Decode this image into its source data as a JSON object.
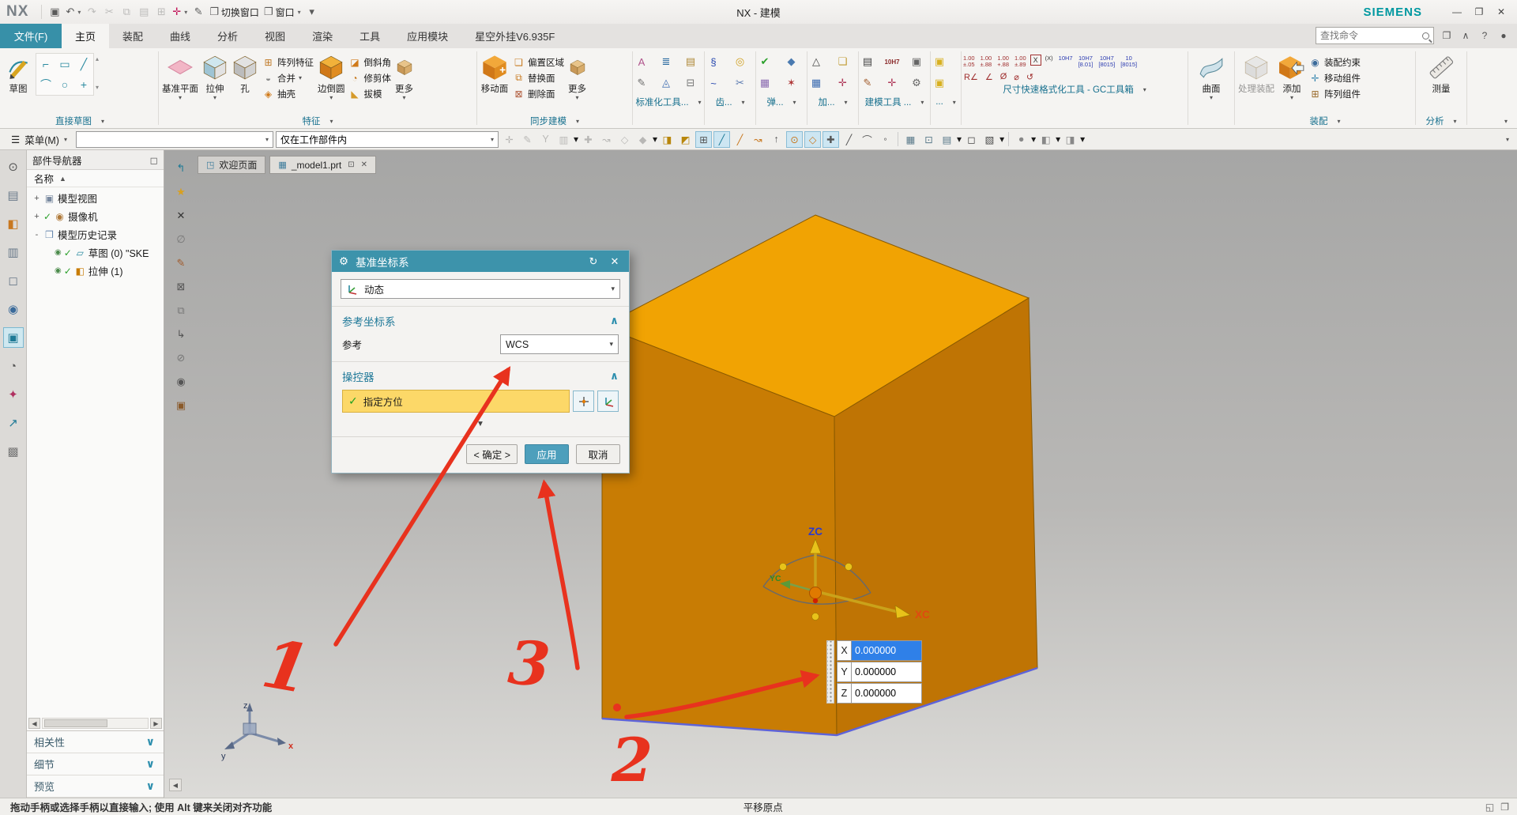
{
  "glyphs": {
    "dropdown": "▾",
    "dropdown_large": "▼",
    "collapse": "∧",
    "expand": "∨",
    "check": "✓",
    "sort": "▲",
    "scroll_left": "◀",
    "scroll_right": "▶",
    "menu": "☰",
    "close": "✕",
    "refresh": "↻",
    "gear": "⚙",
    "pin": "⊡",
    "minimize": "—",
    "maximize": "❐",
    "help": "?",
    "dot": "●",
    "up": "▴",
    "down": "▾",
    "panel": "◻"
  },
  "titlebar": {
    "app_name": "NX",
    "window_title": "NX - 建模",
    "brand": "SIEMENS",
    "icons": [
      {
        "name": "save-icon",
        "glyph": "▣"
      },
      {
        "name": "undo-icon",
        "glyph": "↶",
        "drop": true
      },
      {
        "name": "redo-icon",
        "glyph": "↷",
        "disabled": true
      },
      {
        "name": "cut-icon",
        "glyph": "✂",
        "disabled": true
      },
      {
        "name": "copy-icon",
        "glyph": "⧉",
        "disabled": true
      },
      {
        "name": "paste-icon",
        "glyph": "▤",
        "disabled": true
      },
      {
        "name": "paste-special-icon",
        "glyph": "⊞",
        "disabled": true
      },
      {
        "name": "wcs-orient-icon",
        "glyph": "✛",
        "color": "#c2185b",
        "drop": true
      },
      {
        "name": "brush-icon",
        "glyph": "✎"
      },
      {
        "name": "switch-window-icon",
        "glyph": "❐",
        "label": "切换窗口"
      },
      {
        "name": "window-icon",
        "glyph": "❐",
        "label": "窗口",
        "drop": true
      },
      {
        "name": "qat-overflow-icon",
        "glyph": "▾"
      }
    ],
    "window_buttons": [
      {
        "name": "minimize-button",
        "glyph": "—"
      },
      {
        "name": "maximize-button",
        "glyph": "❐"
      },
      {
        "name": "close-button",
        "glyph": "✕"
      }
    ]
  },
  "menubar": {
    "file_tab": "文件(F)",
    "tabs": [
      "主页",
      "装配",
      "曲线",
      "分析",
      "视图",
      "渲染",
      "工具",
      "应用模块",
      "星空外挂V6.935F"
    ],
    "active_tab": "主页",
    "search_placeholder": "查找命令",
    "right_icons": [
      {
        "name": "fullscreen-icon",
        "glyph": "❐"
      },
      {
        "name": "minimize-ribbon-icon",
        "glyph": "∧"
      },
      {
        "name": "help-icon",
        "glyph": "?"
      },
      {
        "name": "presence-icon",
        "glyph": "●"
      }
    ]
  },
  "ribbon": {
    "sketch": {
      "label_group": "直接草图",
      "button": {
        "label": "草图",
        "icon": "sketch"
      },
      "mini": [
        "⌐",
        "▭",
        "╱",
        "⌒",
        "○",
        "+"
      ]
    },
    "feature": {
      "label_group": "特征",
      "big": [
        {
          "label": "基准平面",
          "icon": "datum-plane",
          "drop": true
        },
        {
          "label": "拉伸",
          "icon": "extrude",
          "drop": true
        },
        {
          "label": "孔",
          "icon": "hole"
        }
      ],
      "stack1": [
        {
          "glyph": "⊞",
          "color": "#c07a28",
          "label": "阵列特征"
        },
        {
          "glyph": "◒",
          "color": "#8a8a8a",
          "label": "合并",
          "drop": true
        },
        {
          "glyph": "◈",
          "color": "#d07a1a",
          "label": "抽壳"
        }
      ],
      "fillet": {
        "label": "边倒圆",
        "icon": "fillet",
        "drop": true
      },
      "stack2": [
        {
          "glyph": "◪",
          "color": "#d07a1a",
          "label": "倒斜角"
        },
        {
          "glyph": "◔",
          "color": "#c87a20",
          "label": "修剪体"
        },
        {
          "glyph": "◣",
          "color": "#d59a2a",
          "label": "拔模"
        }
      ],
      "more": {
        "label": "更多",
        "icon": "more",
        "drop": true
      }
    },
    "sync": {
      "label_group": "同步建模",
      "big": {
        "label": "移动面",
        "icon": "move-face"
      },
      "stack": [
        {
          "glyph": "❏",
          "color": "#c87a20",
          "label": "偏置区域"
        },
        {
          "glyph": "⧉",
          "color": "#c87a20",
          "label": "替换面"
        },
        {
          "glyph": "⊠",
          "color": "#b05a3a",
          "label": "删除面"
        }
      ],
      "more": {
        "label": "更多",
        "icon": "more",
        "drop": true
      }
    },
    "clusters": [
      {
        "label_group": "标准化工具...",
        "icons": [
          {
            "glyph": "A",
            "color": "#b0548c"
          },
          {
            "glyph": "✎",
            "color": "#6a6a6a"
          },
          {
            "glyph": "≣",
            "color": "#2a6aa0"
          },
          {
            "glyph": "◬",
            "color": "#3a6ab0"
          },
          {
            "glyph": "▤",
            "color": "#b08a3a"
          },
          {
            "glyph": "⊟",
            "color": "#777777"
          }
        ]
      },
      {
        "label_group": "齿...",
        "icons": [
          {
            "glyph": "§",
            "color": "#2a4ab0"
          },
          {
            "glyph": "~",
            "color": "#2a4ab0"
          },
          {
            "glyph": "◎",
            "color": "#d0a020"
          },
          {
            "glyph": "✂",
            "color": "#5a7ab0"
          }
        ]
      },
      {
        "label_group": "弹...",
        "icons": [
          {
            "glyph": "✔",
            "color": "#2aa02a"
          },
          {
            "glyph": "▦",
            "color": "#8a6ab0"
          },
          {
            "glyph": "◆",
            "color": "#4a7ab0"
          },
          {
            "glyph": "✶",
            "color": "#b03a3a"
          }
        ]
      },
      {
        "label_group": "加...",
        "icons": [
          {
            "glyph": "△",
            "color": "#444444"
          },
          {
            "glyph": "▦",
            "color": "#3a6ab0"
          },
          {
            "glyph": "❏",
            "color": "#c09a30"
          },
          {
            "glyph": "✛",
            "color": "#b03a5a"
          }
        ]
      },
      {
        "label_group": "建模工具 ...",
        "icons": [
          {
            "glyph": "▤",
            "color": "#444444"
          },
          {
            "glyph": "✎",
            "color": "#a05a2a"
          },
          {
            "glyph": "10H7",
            "color": "#8a2a2a",
            "text": true
          },
          {
            "glyph": "✛",
            "color": "#b03a5a"
          },
          {
            "glyph": "▣",
            "color": "#666666"
          },
          {
            "glyph": "⚙",
            "color": "#666666"
          }
        ]
      },
      {
        "label_group": "...",
        "icons": [
          {
            "glyph": "▣",
            "color": "#d8b020"
          },
          {
            "glyph": "▣",
            "color": "#d8b020"
          }
        ]
      }
    ],
    "gc": {
      "label_group": "尺寸快速格式化工具 - GC工具箱",
      "row1": [
        "1.00\n±.05",
        "1.00\n±.88",
        "1.00\n+.88",
        "1.00\n±.89"
      ],
      "row1_boxed": "X",
      "row1_paren": "(X)",
      "row1_fits": [
        "10H7",
        "10H7\n[8.01]",
        "10H7\n[8015]",
        "10\n[8015]"
      ],
      "row2": [
        "R∠",
        "∠",
        "Ø",
        "⌀",
        "↺"
      ]
    },
    "surface": {
      "label_group": "",
      "button": {
        "label": "曲面",
        "icon": "surface",
        "drop": true
      }
    },
    "assembly": {
      "label_group": "装配",
      "process": {
        "label": "处理装配",
        "icon": "process"
      },
      "add": {
        "label": "添加",
        "icon": "add",
        "drop": true
      },
      "stack": [
        {
          "glyph": "◉",
          "color": "#3a6a9a",
          "label": "装配约束"
        },
        {
          "glyph": "✛",
          "color": "#3a87b0",
          "label": "移动组件"
        },
        {
          "glyph": "⊞",
          "color": "#9a6a2a",
          "label": "阵列组件"
        }
      ]
    },
    "analysis": {
      "label_group": "分析",
      "button": {
        "label": "测量",
        "icon": "measure"
      }
    }
  },
  "toolbar": {
    "menu_button": "菜单(M)",
    "selection_scope": "仅在工作部件内",
    "icons": [
      {
        "name": "extract-icon",
        "glyph": "✛",
        "state": "disabled"
      },
      {
        "name": "sketch-curve-icon",
        "glyph": "✎",
        "state": "disabled"
      },
      {
        "name": "spline-icon",
        "glyph": "Y",
        "state": "disabled"
      },
      {
        "name": "sheet-icon",
        "glyph": "▥",
        "state": "disabled",
        "drop": true
      },
      {
        "name": "anchor-icon",
        "glyph": "✚",
        "state": "disabled"
      },
      {
        "name": "bridge-curve-icon",
        "glyph": "↝",
        "state": "disabled"
      },
      {
        "name": "body-filter-icon",
        "glyph": "◇",
        "state": "disabled"
      },
      {
        "name": "feature-filter-icon",
        "glyph": "◆",
        "state": "disabled",
        "drop": true
      },
      {
        "name": "select-group-icon",
        "glyph": "◨",
        "state": "normal",
        "color": "#b8860b"
      },
      {
        "name": "select-group2-icon",
        "glyph": "◩",
        "state": "normal",
        "color": "#b8860b"
      },
      {
        "name": "snap-point-icon",
        "glyph": "⊞",
        "state": "active",
        "color": "#555555"
      },
      {
        "name": "snap-endpoint-icon",
        "glyph": "╱",
        "state": "active",
        "color": "#1f7a96"
      },
      {
        "name": "snap-midpoint-icon",
        "glyph": "╱",
        "state": "normal",
        "color": "#c87820"
      },
      {
        "name": "snap-curve-icon",
        "glyph": "↝",
        "state": "normal",
        "color": "#c87820"
      },
      {
        "name": "snap-pole-icon",
        "glyph": "↑",
        "state": "normal",
        "color": "#555555"
      },
      {
        "name": "snap-circle-icon",
        "glyph": "⊙",
        "state": "active",
        "color": "#c87820"
      },
      {
        "name": "snap-quadrant-icon",
        "glyph": "◇",
        "state": "active",
        "color": "#c87820"
      },
      {
        "name": "snap-intersection-icon",
        "glyph": "✚",
        "state": "active",
        "color": "#555555"
      },
      {
        "name": "snap-line-icon",
        "glyph": "╱",
        "state": "normal",
        "color": "#555555"
      },
      {
        "name": "snap-arc-icon",
        "glyph": "⌒",
        "state": "normal",
        "color": "#555555"
      },
      {
        "name": "snap-center-icon",
        "glyph": "◦",
        "state": "normal"
      },
      {
        "sep": true
      },
      {
        "name": "shaded-view-icon",
        "glyph": "▦",
        "state": "normal",
        "color": "#5a7a8a"
      },
      {
        "name": "wireframe-view-icon",
        "glyph": "⊡",
        "state": "normal",
        "color": "#5a7a8a"
      },
      {
        "name": "render-style-icon",
        "glyph": "▤",
        "state": "normal",
        "color": "#5a7a8a",
        "drop": true
      },
      {
        "name": "fit-window-icon",
        "glyph": "◻",
        "state": "normal"
      },
      {
        "name": "orient-view-icon",
        "glyph": "▧",
        "state": "normal",
        "drop": true
      },
      {
        "sep": true
      },
      {
        "name": "material-icon",
        "glyph": "●",
        "state": "normal",
        "color": "#888888",
        "drop": true
      },
      {
        "name": "edit-display-icon",
        "glyph": "◧",
        "state": "normal",
        "color": "#888888",
        "drop": true
      },
      {
        "name": "show-hide-icon",
        "glyph": "◨",
        "state": "normal",
        "color": "#888888",
        "drop": true
      }
    ]
  },
  "left_strip": {
    "icons": [
      {
        "name": "spotlight-icon",
        "glyph": "⊙",
        "color": "#555555"
      },
      {
        "name": "assembly-navigator-icon",
        "glyph": "▤",
        "color": "#6a7a8a"
      },
      {
        "name": "constraint-navigator-icon",
        "glyph": "◧",
        "color": "#c87820"
      },
      {
        "name": "part-navigator-icon",
        "glyph": "▥",
        "color": "#6a7a8a"
      },
      {
        "name": "reuse-library-icon",
        "glyph": "◻",
        "color": "#6a7a8a"
      },
      {
        "name": "hd3d-tools-icon",
        "glyph": "◉",
        "color": "#3a6a9a"
      },
      {
        "name": "visualization-icon",
        "glyph": "▣",
        "color": "#1f7a96",
        "selected": true
      },
      {
        "name": "history-icon",
        "glyph": "◔",
        "color": "#555555"
      },
      {
        "name": "roles-icon",
        "glyph": "✦",
        "color": "#b03060"
      },
      {
        "name": "touch-mode-icon",
        "glyph": "↗",
        "color": "#1f7a96"
      },
      {
        "name": "system-visualization-icon",
        "glyph": "▩",
        "color": "#777777"
      }
    ]
  },
  "view_strip": {
    "icons": [
      {
        "name": "back-arrow-icon",
        "glyph": "↰",
        "color": "#1f7a96"
      },
      {
        "name": "favorites-icon",
        "glyph": "★",
        "color": "#d8a020"
      },
      {
        "name": "close-icon",
        "glyph": "✕",
        "color": "#333333"
      },
      {
        "name": "empty-set-icon",
        "glyph": "∅",
        "color": "#777777"
      },
      {
        "name": "edit-icon",
        "glyph": "✎",
        "color": "#a05a2a"
      },
      {
        "name": "delete-box-icon",
        "glyph": "⊠",
        "color": "#555555"
      },
      {
        "name": "copy-sheet-icon",
        "glyph": "⧉",
        "color": "#777777"
      },
      {
        "name": "redirect-icon",
        "glyph": "↳",
        "color": "#555555"
      },
      {
        "name": "no-entry-icon",
        "glyph": "⊘",
        "color": "#777777"
      },
      {
        "name": "show-icon",
        "glyph": "◉",
        "color": "#555555"
      },
      {
        "name": "box-icon",
        "glyph": "▣",
        "color": "#8a5a2a"
      }
    ]
  },
  "part_navigator": {
    "title": "部件导航器",
    "column_name": "名称",
    "tree": [
      {
        "expander": "+",
        "glyph": "▣",
        "glyph_color": "#7a8aa0",
        "label": "模型视图"
      },
      {
        "expander": "+",
        "check": true,
        "glyph": "◉",
        "glyph_color": "#b07a3a",
        "label": "摄像机"
      },
      {
        "expander": "-",
        "glyph": "❒",
        "glyph_color": "#6a8ab0",
        "label": "模型历史记录"
      },
      {
        "indent": 1,
        "radio": true,
        "check": true,
        "glyph": "▱",
        "glyph_color": "#2a8aa0",
        "label": "草图 (0) \"SKE"
      },
      {
        "indent": 1,
        "radio": true,
        "check": true,
        "glyph": "◧",
        "glyph_color": "#c87c04",
        "label": "拉伸 (1)"
      }
    ],
    "bottom_sections": [
      "相关性",
      "细节",
      "预览"
    ]
  },
  "viewport": {
    "tabs": [
      {
        "label": "欢迎页面",
        "icon": "◳",
        "active": false
      },
      {
        "label": "_model1.prt",
        "icon": "▦",
        "pin": "⊡",
        "close": "✕",
        "active": true
      }
    ]
  },
  "dialog": {
    "title": "基准坐标系",
    "type_value": "动态",
    "ref_section": "参考坐标系",
    "ref_label": "参考",
    "ref_value": "WCS",
    "manip_section": "操控器",
    "orient_label": "指定方位",
    "ok": "< 确定 >",
    "apply": "应用",
    "cancel": "取消"
  },
  "wcs_triad": {
    "z_label": "ZC",
    "x_label": "XC",
    "y_label": "YC"
  },
  "origin_triad": {
    "z_label": "z",
    "x_label": "x",
    "y_label": "y"
  },
  "coord_box": {
    "rows": [
      {
        "axis": "X",
        "value": "0.000000",
        "selected": true
      },
      {
        "axis": "Y",
        "value": "0.000000",
        "selected": false
      },
      {
        "axis": "Z",
        "value": "0.000000",
        "selected": false
      }
    ]
  },
  "annotations": {
    "digits": [
      {
        "text": "1"
      },
      {
        "text": "3"
      },
      {
        "text": "2"
      }
    ]
  },
  "statusbar": {
    "message": "拖动手柄或选择手柄以直接输入;  使用 Alt 键来关闭对齐功能",
    "center_label": "平移原点",
    "right_icons": [
      {
        "name": "clip-icon",
        "glyph": "◱"
      },
      {
        "name": "expand-work-area-icon",
        "glyph": "❐"
      }
    ]
  },
  "colors": {
    "accent_teal": "#3790a8",
    "selection_blue": "#2f80e8",
    "annotation_red": "#e8321e",
    "highlight_yellow": "#fcd868",
    "cube_top": "#f1a303",
    "cube_left": "#c87c04",
    "cube_right": "#bf7404"
  }
}
